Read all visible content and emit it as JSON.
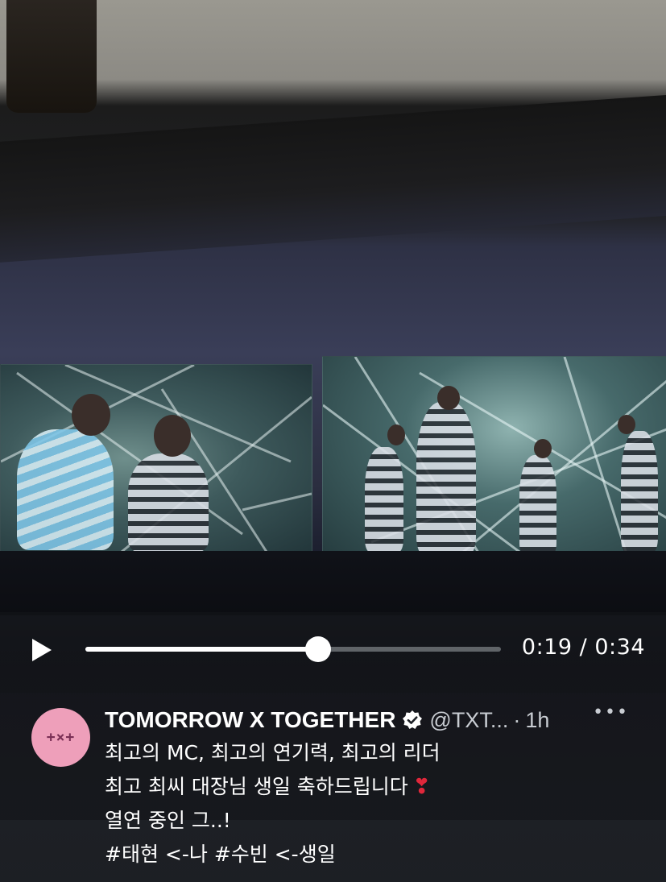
{
  "player": {
    "current_time": "0:19",
    "duration": "0:34",
    "time_separator": "/",
    "progress": 0.56
  },
  "tweet": {
    "avatar_text": "+×+",
    "author_name": "TOMORROW X TOGETHER",
    "verified": true,
    "handle": "@TXT...",
    "separator": "·",
    "timestamp": "1h",
    "more_label": "•••",
    "lines": [
      "최고의 MC, 최고의 연기력, 최고의 리더",
      "최고 최씨 대장님 생일 축하드립니다",
      "열연 중인 그..!"
    ],
    "emoji": "❣",
    "hashtag_line": {
      "tag1": "#태현",
      "text1": " <-나 ",
      "tag2": "#수빈",
      "text2": " <-생일"
    }
  },
  "colors": {
    "avatar_bg": "#ee9fba",
    "accent": "#ffffff",
    "heart": "#e0273b"
  }
}
